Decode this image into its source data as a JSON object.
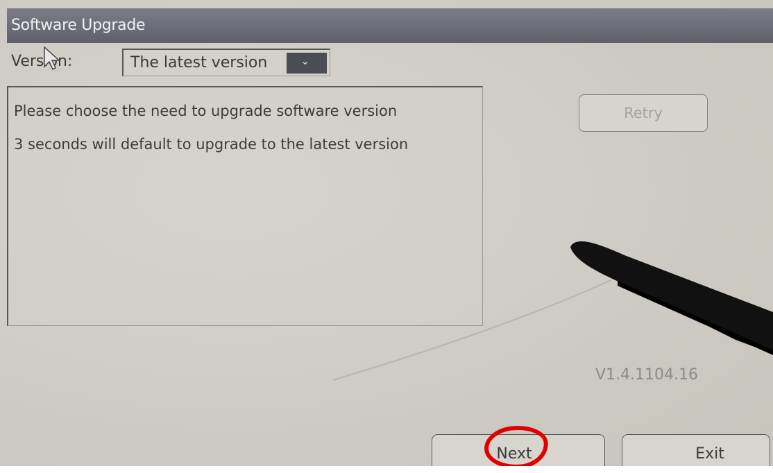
{
  "window": {
    "title": "Software Upgrade"
  },
  "version_select": {
    "label": "Version:",
    "selected": "The latest version",
    "dropdown_icon": "chevron-down-icon"
  },
  "message": {
    "line1": "Please choose the need to upgrade software version",
    "line2": "3 seconds will default to upgrade to the latest version"
  },
  "buttons": {
    "retry": "Retry",
    "next": "Next",
    "exit": "Exit"
  },
  "version_number": "V1.4.1104.16",
  "colors": {
    "title_bar": "#6e6f78",
    "annotation_red": "#e00000"
  }
}
